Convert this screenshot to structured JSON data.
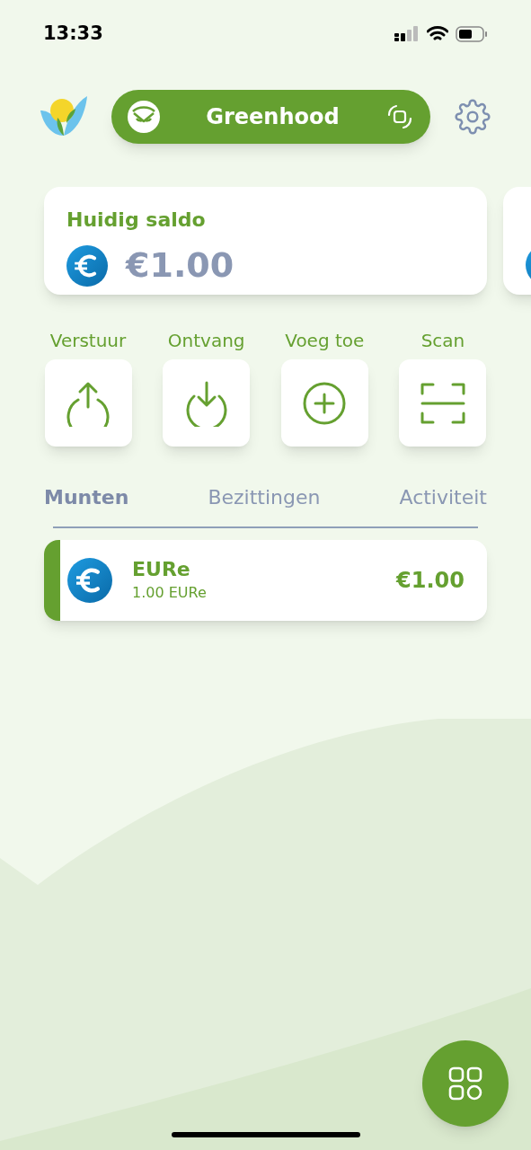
{
  "status_bar": {
    "time": "13:33"
  },
  "header": {
    "account_name": "Greenhood"
  },
  "balance_card": {
    "title": "Huidig saldo",
    "amount": "€1.00"
  },
  "actions": [
    {
      "kind": "send",
      "label": "Verstuur"
    },
    {
      "kind": "receive",
      "label": "Ontvang"
    },
    {
      "kind": "add",
      "label": "Voeg toe"
    },
    {
      "kind": "scan",
      "label": "Scan"
    }
  ],
  "tabs": [
    {
      "label": "Munten",
      "selected": true
    },
    {
      "label": "Bezittingen",
      "selected": false
    },
    {
      "label": "Activiteit",
      "selected": false
    }
  ],
  "tokens": [
    {
      "name": "EURe",
      "balance": "1.00 EURe",
      "value": "€1.00",
      "color": "#65a030"
    }
  ]
}
